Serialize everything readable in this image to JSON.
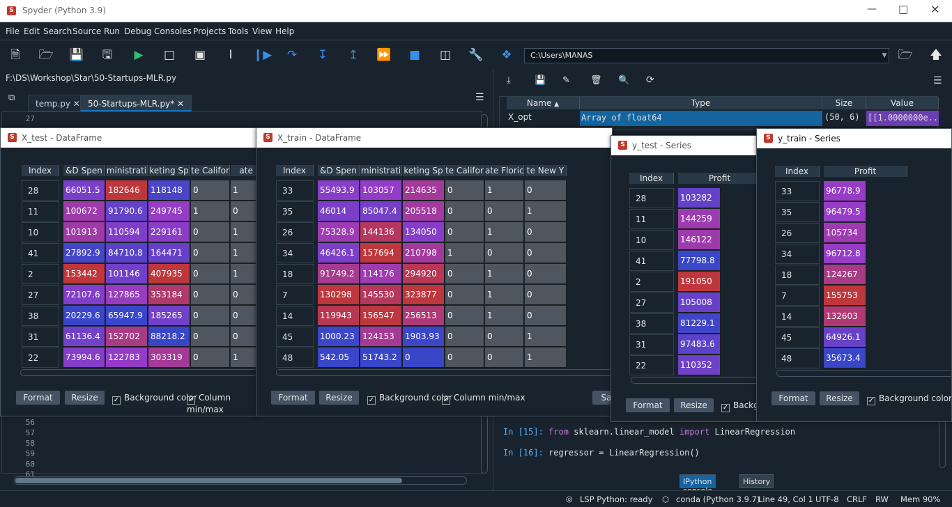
{
  "app": {
    "title": "Spyder (Python 3.9)"
  },
  "menu": [
    "File",
    "Edit",
    "Search",
    "Source",
    "Run",
    "Debug",
    "Consoles",
    "Projects",
    "Tools",
    "View",
    "Help"
  ],
  "toolbar": {
    "path": "C:\\Users\\MANAS"
  },
  "editor": {
    "filepath": "F:\\DS\\Workshop\\Star\\50-Startups-MLR.py",
    "tabs": [
      "temp.py",
      "50-Startups-MLR.py*"
    ],
    "line_numbers": [
      "27",
      "56",
      "57",
      "58",
      "59",
      "60",
      "61"
    ]
  },
  "variable_explorer": {
    "headers": [
      "Name",
      "Type",
      "Size",
      "Value"
    ],
    "row": {
      "name": "X_opt",
      "type": "Array of float64",
      "size": "(50, 6)",
      "value": "[[1.0000000e..."
    }
  },
  "console": {
    "lines": [
      {
        "prompt": "In [15]:",
        "kw1": "from",
        "mid": " sklearn.linear_model ",
        "kw2": "import",
        "rest": " LinearRegression"
      },
      {
        "prompt": "In [16]:",
        "code": "regressor = LinearRegression()"
      }
    ],
    "tabs": [
      "IPython console",
      "History"
    ]
  },
  "statusbar": {
    "lsp": "LSP Python: ready",
    "env": "conda (Python 3.9.7)",
    "pos": "Line 49, Col 1",
    "enc": "UTF-8",
    "eol": "CRLF",
    "rw": "RW",
    "mem": "Mem 90%"
  },
  "common": {
    "format": "Format",
    "resize": "Resize",
    "bgcolor": "Background color",
    "minmax": "Column min/max",
    "save": "Sa",
    "check": "✓"
  },
  "xtest": {
    "title": "X_test - DataFrame",
    "index_label": "Index",
    "headers": [
      "&D Spen",
      "ministrati",
      "keting Sp",
      "te Califor",
      "ate F"
    ],
    "rows": [
      {
        "i": "28",
        "c": [
          "66051.5",
          "182646",
          "118148",
          "0",
          "1"
        ]
      },
      {
        "i": "11",
        "c": [
          "100672",
          "91790.6",
          "249745",
          "1",
          "0"
        ]
      },
      {
        "i": "10",
        "c": [
          "101913",
          "110594",
          "229161",
          "0",
          "1"
        ]
      },
      {
        "i": "41",
        "c": [
          "27892.9",
          "84710.8",
          "164471",
          "0",
          "1"
        ]
      },
      {
        "i": "2",
        "c": [
          "153442",
          "101146",
          "407935",
          "0",
          "1"
        ]
      },
      {
        "i": "27",
        "c": [
          "72107.6",
          "127865",
          "353184",
          "0",
          "0"
        ]
      },
      {
        "i": "38",
        "c": [
          "20229.6",
          "65947.9",
          "185265",
          "0",
          "0"
        ]
      },
      {
        "i": "31",
        "c": [
          "61136.4",
          "152702",
          "88218.2",
          "0",
          "0"
        ]
      },
      {
        "i": "22",
        "c": [
          "73994.6",
          "122783",
          "303319",
          "0",
          "1"
        ]
      }
    ]
  },
  "xtrain": {
    "title": "X_train - DataFrame",
    "index_label": "Index",
    "headers": [
      "&D Spen",
      "ministrati",
      "keting Sp",
      "te Califor",
      "ate Floric",
      "te New Y"
    ],
    "rows": [
      {
        "i": "33",
        "c": [
          "55493.9",
          "103057",
          "214635",
          "0",
          "1",
          "0"
        ]
      },
      {
        "i": "35",
        "c": [
          "46014",
          "85047.4",
          "205518",
          "0",
          "0",
          "1"
        ]
      },
      {
        "i": "26",
        "c": [
          "75328.9",
          "144136",
          "134050",
          "0",
          "1",
          "0"
        ]
      },
      {
        "i": "34",
        "c": [
          "46426.1",
          "157694",
          "210798",
          "1",
          "0",
          "0"
        ]
      },
      {
        "i": "18",
        "c": [
          "91749.2",
          "114176",
          "294920",
          "0",
          "1",
          "0"
        ]
      },
      {
        "i": "7",
        "c": [
          "130298",
          "145530",
          "323877",
          "0",
          "1",
          "0"
        ]
      },
      {
        "i": "14",
        "c": [
          "119943",
          "156547",
          "256513",
          "0",
          "1",
          "0"
        ]
      },
      {
        "i": "45",
        "c": [
          "1000.23",
          "124153",
          "1903.93",
          "0",
          "0",
          "1"
        ]
      },
      {
        "i": "48",
        "c": [
          "542.05",
          "51743.2",
          "0",
          "0",
          "0",
          "1"
        ]
      }
    ]
  },
  "ytest": {
    "title": "y_test - Series",
    "index_label": "Index",
    "header": "Profit",
    "bg_label": "Backgr",
    "rows": [
      {
        "i": "28",
        "v": "103282"
      },
      {
        "i": "11",
        "v": "144259"
      },
      {
        "i": "10",
        "v": "146122"
      },
      {
        "i": "41",
        "v": "77798.8"
      },
      {
        "i": "2",
        "v": "191050"
      },
      {
        "i": "27",
        "v": "105008"
      },
      {
        "i": "38",
        "v": "81229.1"
      },
      {
        "i": "31",
        "v": "97483.6"
      },
      {
        "i": "22",
        "v": "110352"
      }
    ]
  },
  "ytrain": {
    "title": "y_train - Series",
    "index_label": "Index",
    "header": "Profit",
    "rows": [
      {
        "i": "33",
        "v": "96778.9"
      },
      {
        "i": "35",
        "v": "96479.5"
      },
      {
        "i": "26",
        "v": "105734"
      },
      {
        "i": "34",
        "v": "96712.8"
      },
      {
        "i": "18",
        "v": "124267"
      },
      {
        "i": "7",
        "v": "155753"
      },
      {
        "i": "14",
        "v": "132603"
      },
      {
        "i": "45",
        "v": "64926.1"
      },
      {
        "i": "48",
        "v": "35673.4"
      }
    ]
  }
}
